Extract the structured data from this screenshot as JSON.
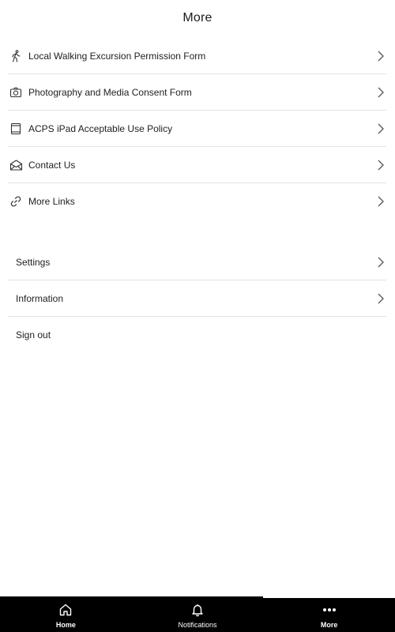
{
  "header": {
    "title": "More"
  },
  "primary_items": [
    {
      "label": "Local Walking Excursion Permission Form",
      "icon": "walking-person-icon"
    },
    {
      "label": "Photography and Media Consent Form",
      "icon": "camera-icon"
    },
    {
      "label": "ACPS iPad Acceptable Use Policy",
      "icon": "tablet-icon"
    },
    {
      "label": "Contact Us",
      "icon": "envelope-icon"
    },
    {
      "label": "More Links",
      "icon": "link-icon"
    }
  ],
  "secondary_items": [
    {
      "label": "Settings"
    },
    {
      "label": "Information"
    },
    {
      "label": "Sign out"
    }
  ],
  "tabbar": {
    "tabs": [
      {
        "label": "Home",
        "icon": "home-icon",
        "active": false
      },
      {
        "label": "Notifications",
        "icon": "bell-icon",
        "active": false
      },
      {
        "label": "More",
        "icon": "more-dots-icon",
        "active": true
      }
    ]
  },
  "colors": {
    "tabbar_bg": "#000000",
    "divider": "#e3e3e3",
    "text": "#222222"
  }
}
